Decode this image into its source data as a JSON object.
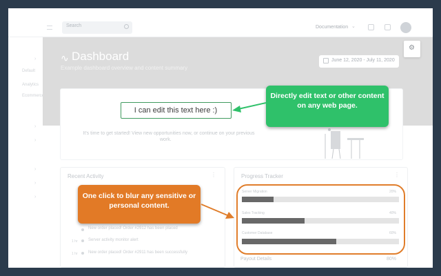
{
  "colors": {
    "background": "#2b3b4c",
    "green_callout": "#2fc16a",
    "orange_callout": "#e27a26",
    "edit_border": "#3f9a5e",
    "progress_dark": "#686868",
    "header_band": "#dcdcdc"
  },
  "topbar": {
    "search_placeholder": "Search",
    "doc_link": "Documentation",
    "icons": [
      "menu-icon",
      "search-icon",
      "bell-icon",
      "mail-icon",
      "avatar"
    ]
  },
  "sidebar": {
    "items": [
      "Default",
      "Analytics",
      "Ecommerce"
    ]
  },
  "header": {
    "title": "Dashboard",
    "subtitle": "Example dashboard overview and content summary",
    "date_range": "June 12, 2020 - July 11, 2020"
  },
  "welcome": {
    "edited_text": "I can edit this text here :)",
    "body_line_1": "It's time to get started! View new opportunities now, or continue on your previous",
    "body_line_2": "work."
  },
  "recent_activity": {
    "title": "Recent Activity",
    "items": [
      {
        "time": "",
        "text": "New order placed! Order #2912 has been placed"
      },
      {
        "time": "1 hr",
        "text": "Server activity monitor alert"
      },
      {
        "time": "1 hr",
        "text": "New order placed! Order #2911 has been successfully"
      }
    ]
  },
  "progress_tracker": {
    "title": "Progress Tracker",
    "bars": [
      {
        "label": "Server Migration",
        "percent_label": "20%",
        "value": 20
      },
      {
        "label": "Sales Tracking",
        "percent_label": "40%",
        "value": 40
      },
      {
        "label": "Customer Database",
        "percent_label": "60%",
        "value": 60
      }
    ],
    "payout_label": "Payout Details",
    "payout_value": "80%"
  },
  "callouts": {
    "green": "Directly edit text or other content on any web page.",
    "orange": "One click to blur any sensitive or personal content."
  }
}
